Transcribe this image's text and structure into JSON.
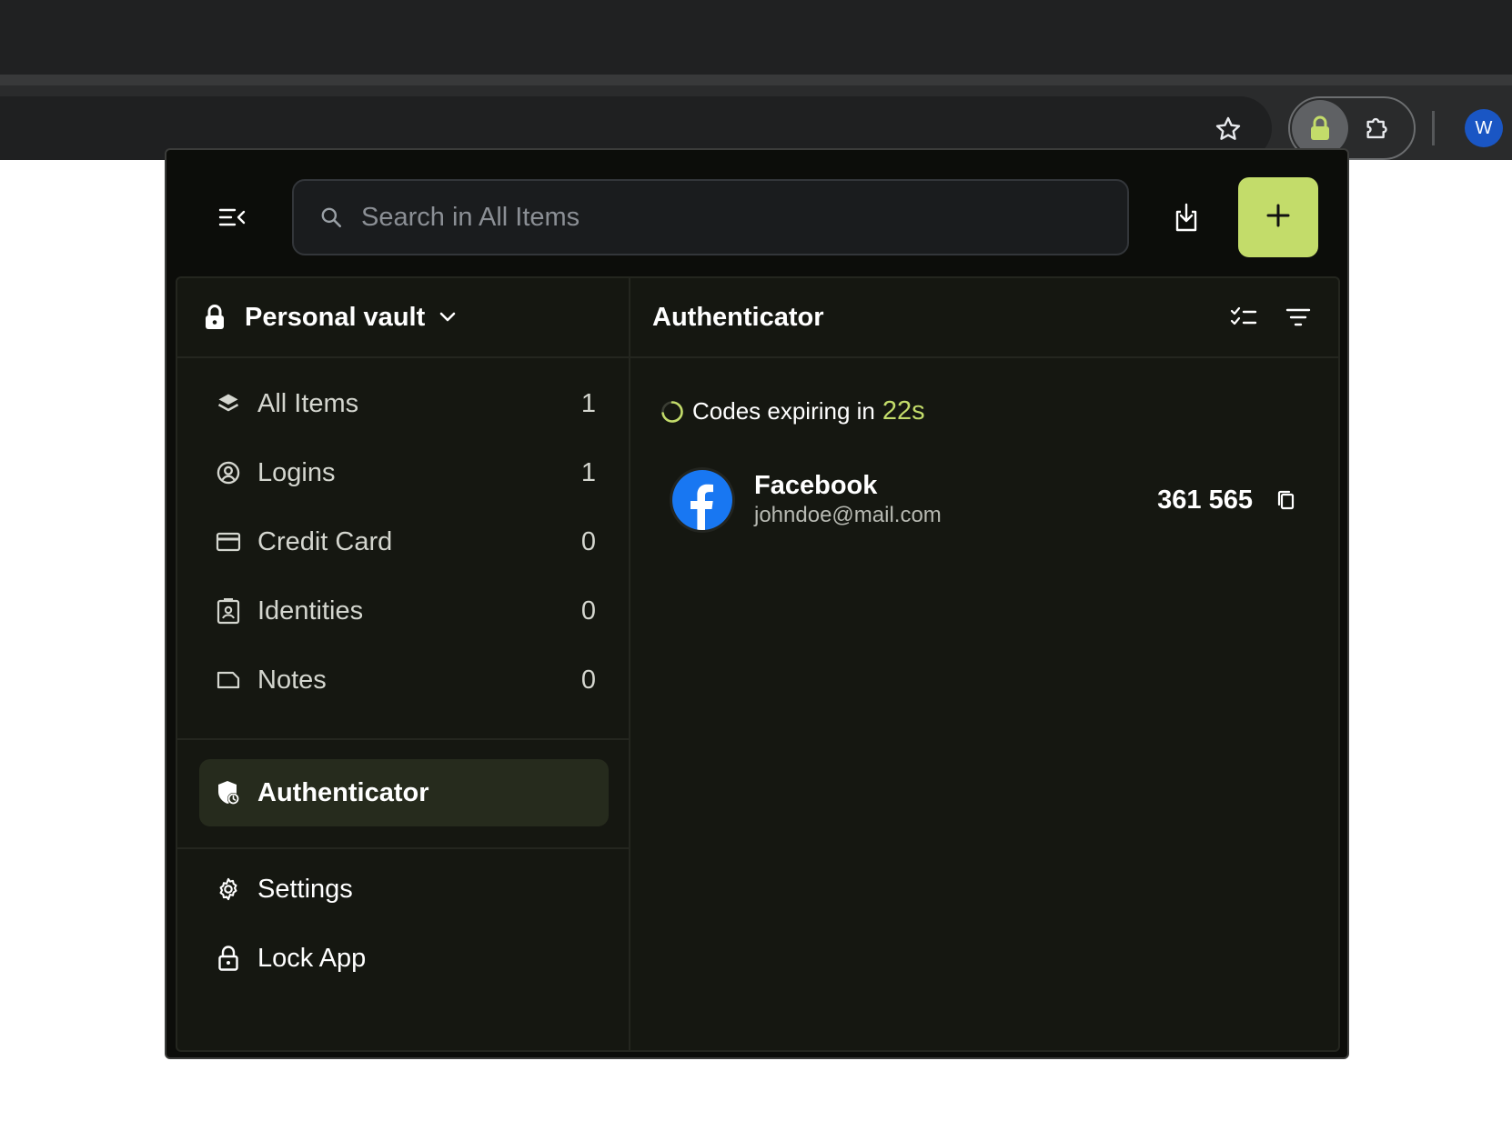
{
  "browser": {
    "avatar_letter": "W",
    "icons": [
      "star-icon",
      "password-manager-lock-icon",
      "extensions-puzzle-icon"
    ]
  },
  "toolbar": {
    "search_placeholder": "Search in All Items",
    "icons": [
      "menu-collapse-icon",
      "search-icon",
      "import-icon",
      "plus-icon"
    ],
    "accent_color": "#c3dc6a"
  },
  "vault": {
    "name": "Personal vault"
  },
  "nav": {
    "items": [
      {
        "label": "All Items",
        "count": "1",
        "icon": "layers-icon"
      },
      {
        "label": "Logins",
        "count": "1",
        "icon": "user-circle-icon"
      },
      {
        "label": "Credit Card",
        "count": "0",
        "icon": "credit-card-icon"
      },
      {
        "label": "Identities",
        "count": "0",
        "icon": "id-badge-icon"
      },
      {
        "label": "Notes",
        "count": "0",
        "icon": "note-icon"
      }
    ],
    "active": {
      "label": "Authenticator",
      "icon": "shield-clock-icon"
    },
    "footer": [
      {
        "label": "Settings",
        "icon": "gear-icon"
      },
      {
        "label": "Lock App",
        "icon": "lock-icon"
      }
    ]
  },
  "main": {
    "title": "Authenticator",
    "expiry_text": "Codes expiring in",
    "expiry_seconds": "22s",
    "entries": [
      {
        "service": "Facebook",
        "username": "johndoe@mail.com",
        "code": "361 565",
        "icon": "facebook-icon"
      }
    ]
  }
}
